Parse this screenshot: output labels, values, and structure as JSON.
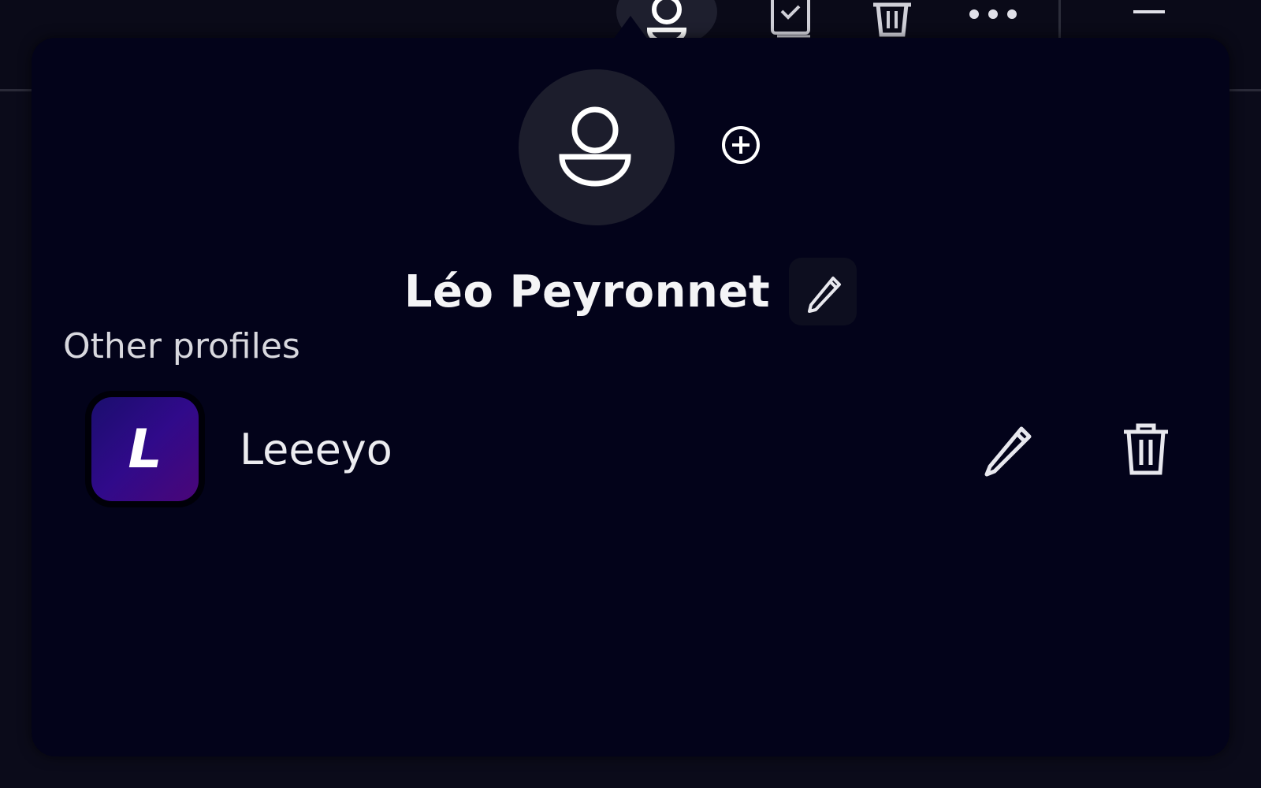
{
  "profile": {
    "name": "Léo Peyronnet"
  },
  "other_profiles": {
    "label": "Other profiles",
    "items": [
      {
        "initial": "L",
        "name": "Leeeyo"
      }
    ]
  },
  "colors": {
    "background": "#0b0b1a",
    "popover": "#03031a",
    "avatar_circle": "#1c1d2c",
    "profile_gradient_start": "#1b0e6e",
    "profile_gradient_end": "#4a0678"
  },
  "icons": {
    "toolbar": [
      "user-icon",
      "checklist-icon",
      "trash-icon",
      "more-icon",
      "minimize-icon"
    ],
    "main_avatar": "user-icon",
    "add_profile": "plus-circle-icon",
    "edit": "pencil-icon",
    "delete": "trash-icon"
  }
}
